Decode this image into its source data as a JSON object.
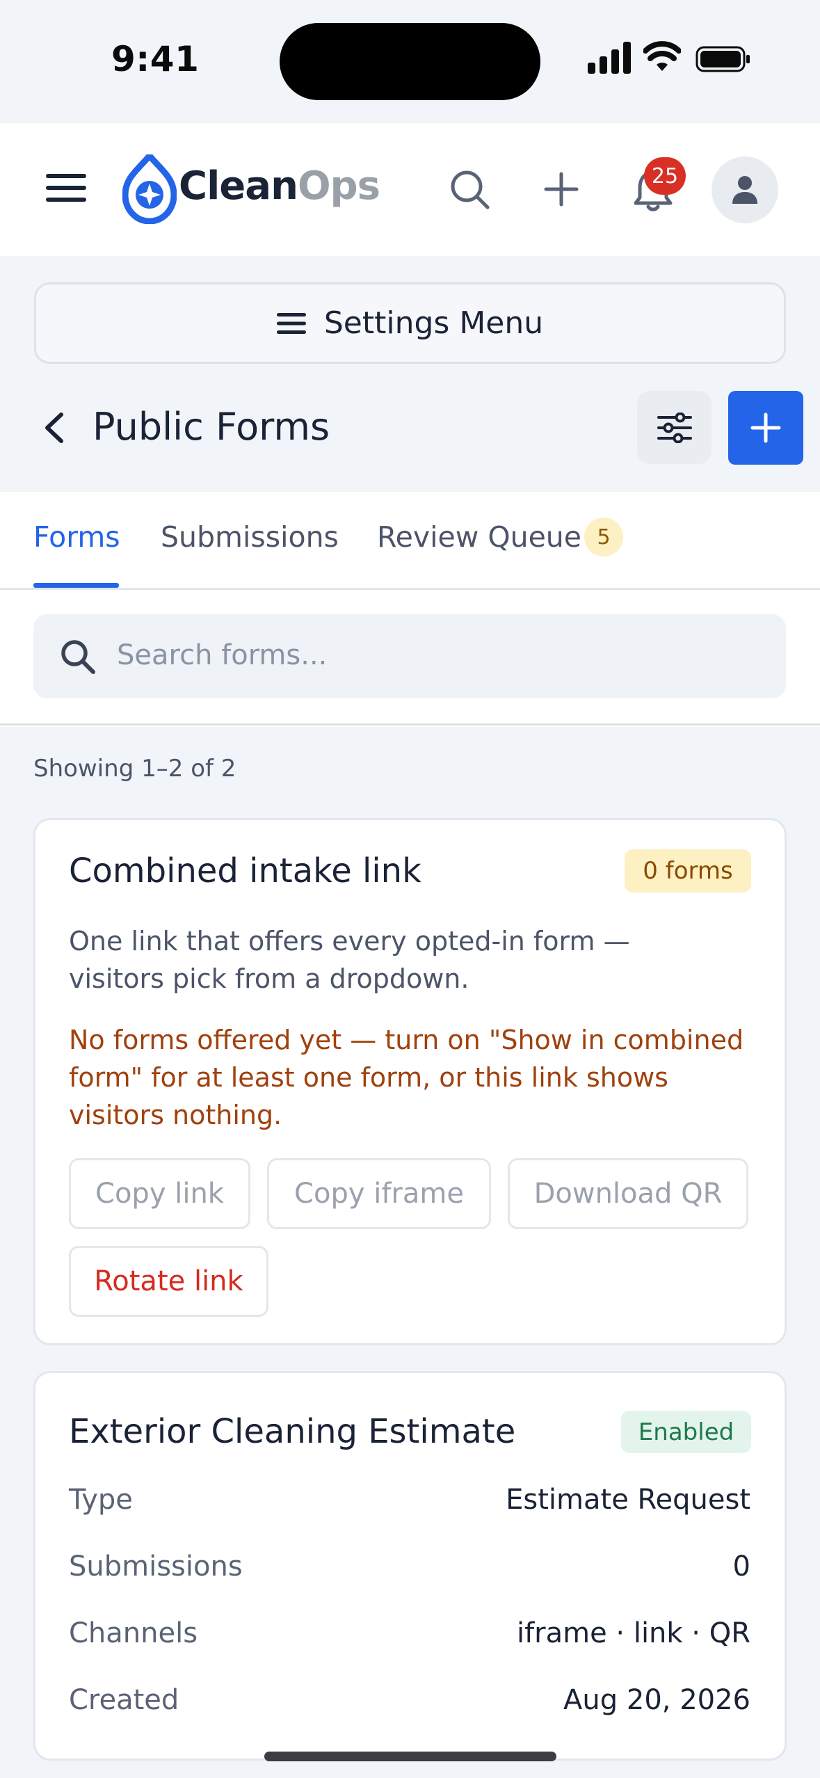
{
  "status_bar": {
    "time": "9:41"
  },
  "header": {
    "logo_part1": "Clean",
    "logo_part2": "Ops",
    "notification_count": "25"
  },
  "settings_menu": {
    "label": "Settings Menu"
  },
  "page": {
    "title": "Public Forms"
  },
  "tabs": [
    {
      "label": "Forms",
      "active": true
    },
    {
      "label": "Submissions",
      "active": false
    },
    {
      "label": "Review Queue",
      "badge": "5",
      "active": false
    }
  ],
  "search": {
    "placeholder": "Search forms..."
  },
  "results": {
    "showing": "Showing 1–2 of 2"
  },
  "combined_card": {
    "title": "Combined intake link",
    "badge": "0 forms",
    "description": "One link that offers every opted-in form — visitors pick from a dropdown.",
    "warning": "No forms offered yet — turn on \"Show in combined form\" for at least one form, or this link shows visitors nothing.",
    "buttons": {
      "copy_link": "Copy link",
      "copy_iframe": "Copy iframe",
      "download_qr": "Download QR",
      "rotate_link": "Rotate link"
    }
  },
  "form_card": {
    "title": "Exterior Cleaning Estimate",
    "status": "Enabled",
    "rows": [
      {
        "label": "Type",
        "value": "Estimate Request"
      },
      {
        "label": "Submissions",
        "value": "0"
      },
      {
        "label": "Channels",
        "value": "iframe · link · QR"
      },
      {
        "label": "Created",
        "value": "Aug 20, 2026"
      }
    ]
  },
  "colors": {
    "accent": "#2464e8",
    "danger": "#d52b1e",
    "warning_text": "#a0410d",
    "success_text": "#1d7a4b"
  }
}
